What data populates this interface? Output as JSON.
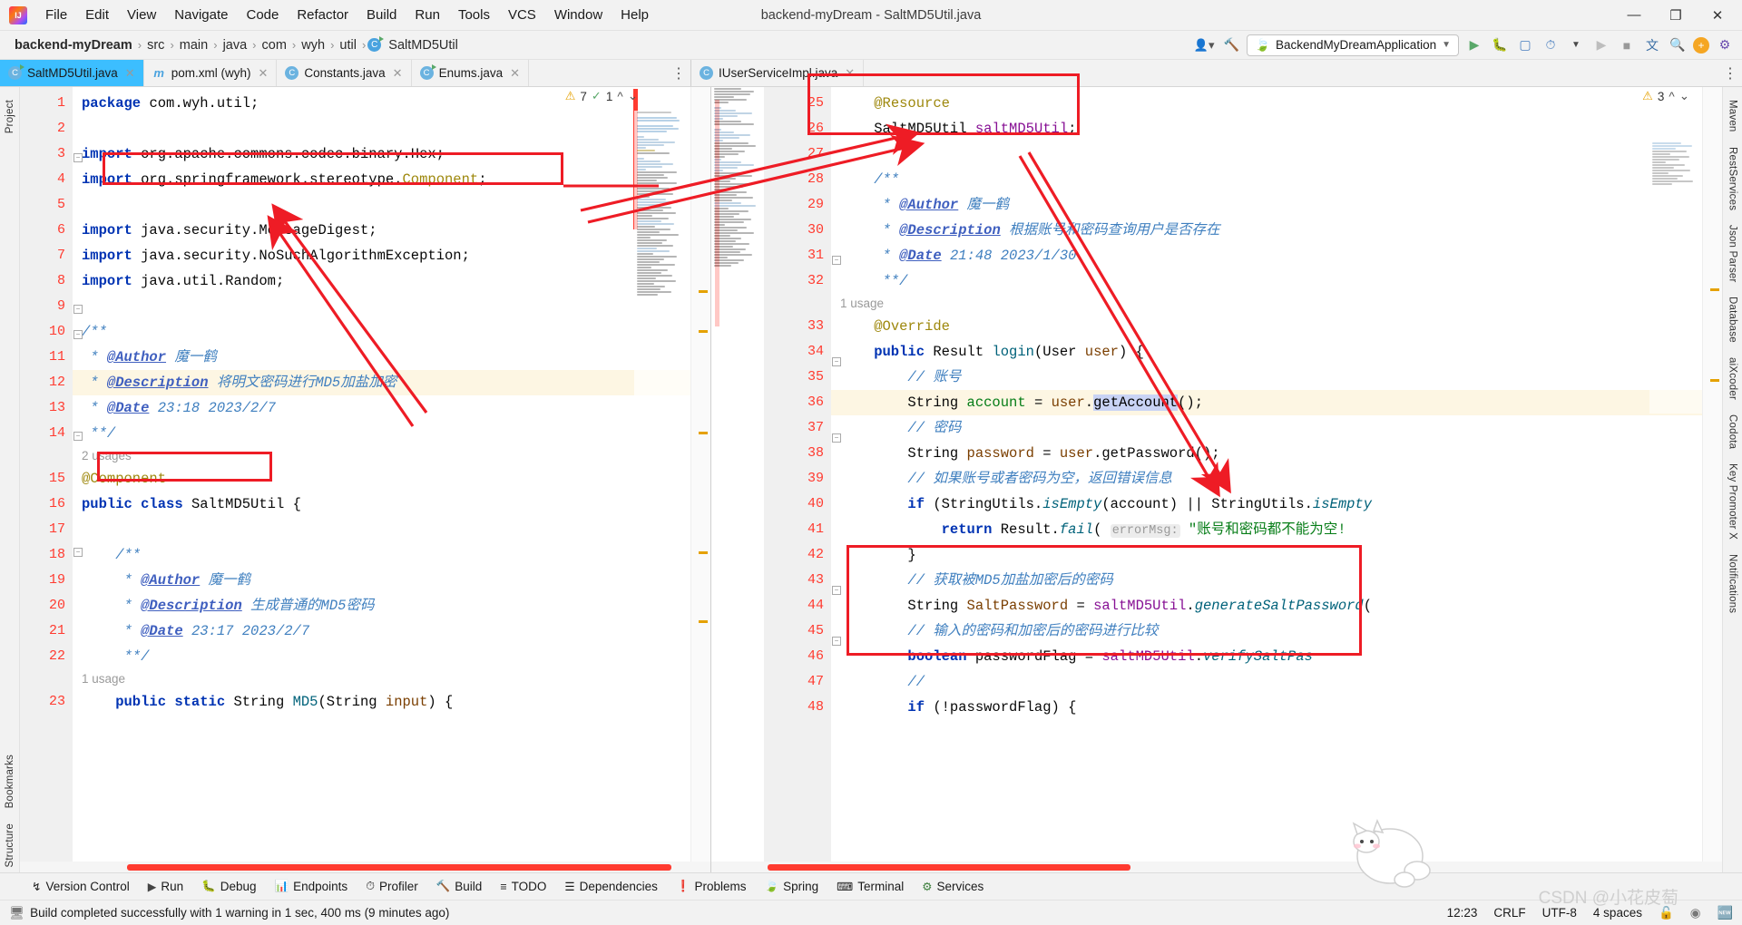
{
  "window": {
    "title": "backend-myDream - SaltMD5Util.java",
    "logo": "intellij-idea-logo",
    "controls": {
      "minimize": "—",
      "maximize": "❐",
      "close": "✕"
    }
  },
  "menubar": {
    "items": [
      "File",
      "Edit",
      "View",
      "Navigate",
      "Code",
      "Refactor",
      "Build",
      "Run",
      "Tools",
      "VCS",
      "Window",
      "Help"
    ]
  },
  "navbar": {
    "crumbs": [
      "backend-myDream",
      "src",
      "main",
      "java",
      "com",
      "wyh",
      "util",
      "SaltMD5Util"
    ],
    "separator": "›",
    "run_config": "BackendMyDreamApplication",
    "right_icons": [
      "account-icon",
      "hammer-icon",
      "run-icon",
      "debug-icon",
      "run-coverage-icon",
      "profile-icon",
      "stop-icon",
      "translate-icon",
      "search-icon",
      "updates-icon",
      "settings-icon"
    ]
  },
  "tabs_left": [
    {
      "label": "SaltMD5Util.java",
      "icon": "java-class-icon",
      "active": true
    },
    {
      "label": "pom.xml (wyh)",
      "icon": "maven-icon",
      "active": false
    },
    {
      "label": "Constants.java",
      "icon": "java-class-icon",
      "active": false
    },
    {
      "label": "Enums.java",
      "icon": "java-class-icon",
      "active": false
    }
  ],
  "tabs_right": [
    {
      "label": "IUserServiceImpl.java",
      "icon": "java-class-icon",
      "active": true
    }
  ],
  "left_rail": {
    "top": "Project",
    "bottom": [
      "Bookmarks",
      "Structure"
    ]
  },
  "right_rail": {
    "items": [
      "Maven",
      "RestServices",
      "Json Parser",
      "Database",
      "aiXcoder",
      "Codota",
      "Key Promoter X",
      "Notifications"
    ]
  },
  "inspections": {
    "left": {
      "warnings": "7",
      "checks": "1"
    },
    "right": {
      "warnings": "3"
    }
  },
  "editor_left": {
    "file": "SaltMD5Util.java",
    "first_line": 1,
    "lines": [
      {
        "n": 1,
        "text": "package com.wyh.util;"
      },
      {
        "n": 2,
        "text": ""
      },
      {
        "n": 3,
        "text": "import org.apache.commons.codec.binary.Hex;"
      },
      {
        "n": 4,
        "text": "import org.springframework.stereotype.Component;"
      },
      {
        "n": 5,
        "text": ""
      },
      {
        "n": 6,
        "text": "import java.security.MessageDigest;"
      },
      {
        "n": 7,
        "text": "import java.security.NoSuchAlgorithmException;"
      },
      {
        "n": 8,
        "text": "import java.util.Random;"
      },
      {
        "n": 9,
        "text": ""
      },
      {
        "n": 10,
        "text": "/**"
      },
      {
        "n": 11,
        "text": " * @Author 魏一鹤"
      },
      {
        "n": 12,
        "text": " * @Description 将明文密码进行MD5加盐加密"
      },
      {
        "n": 13,
        "text": " * @Date 23:18 2023/2/7"
      },
      {
        "n": 14,
        "text": " **/"
      },
      {
        "n": 15,
        "text": "@Component",
        "above": "2 usages"
      },
      {
        "n": 16,
        "text": "public class SaltMD5Util {"
      },
      {
        "n": 17,
        "text": ""
      },
      {
        "n": 18,
        "text": "    /**"
      },
      {
        "n": 19,
        "text": "     * @Author 魏一鹤"
      },
      {
        "n": 20,
        "text": "     * @Description 生成普通的MD5密码"
      },
      {
        "n": 21,
        "text": "     * @Date 23:17 2023/2/7"
      },
      {
        "n": 22,
        "text": "     **/"
      },
      {
        "n": 23,
        "text": "    public static String MD5(String input) {",
        "above": "1 usage"
      }
    ]
  },
  "editor_right": {
    "file": "IUserServiceImpl.java",
    "lines": [
      {
        "n": 25,
        "text": "    @Resource"
      },
      {
        "n": 26,
        "text": "    SaltMD5Util saltMD5Util;"
      },
      {
        "n": 27,
        "text": ""
      },
      {
        "n": 28,
        "text": "    /**"
      },
      {
        "n": 29,
        "text": "     * @Author 魏一鹤"
      },
      {
        "n": 30,
        "text": "     * @Description 根据账号和密码查询用户是否存在"
      },
      {
        "n": 31,
        "text": "     * @Date 21:48 2023/1/30"
      },
      {
        "n": 32,
        "text": "     **/"
      },
      {
        "n": 33,
        "text": "    @Override",
        "above": "1 usage"
      },
      {
        "n": 34,
        "text": "    public Result login(User user) {"
      },
      {
        "n": 35,
        "text": "        // 账号"
      },
      {
        "n": 36,
        "text": "        String account = user.getAccount();"
      },
      {
        "n": 37,
        "text": "        // 密码"
      },
      {
        "n": 38,
        "text": "        String password = user.getPassword();"
      },
      {
        "n": 39,
        "text": "        // 如果账号或者密码为空，返回错误信息"
      },
      {
        "n": 40,
        "text": "        if (StringUtils.isEmpty(account) || StringUtils.isEmpty"
      },
      {
        "n": 41,
        "text": "            return Result.fail( errorMsg: \"账号和密码都不能为空!"
      },
      {
        "n": 42,
        "text": "        }"
      },
      {
        "n": 43,
        "text": "        // 获取被MD5加盐加密后的密码"
      },
      {
        "n": 44,
        "text": "        String SaltPassword = saltMD5Util.generateSaltPassword("
      },
      {
        "n": 45,
        "text": "        // 输入的密码和加密后的密码进行比较"
      },
      {
        "n": 46,
        "text": "        boolean passwordFlag = saltMD5Util.verifySaltPas"
      },
      {
        "n": 47,
        "text": "        //"
      },
      {
        "n": 48,
        "text": "        if (!passwordFlag) {"
      }
    ]
  },
  "annotations": {
    "boxes": [
      "import-component-box",
      "component-annotation-box",
      "resource-field-box",
      "salt-md5-usage-box"
    ],
    "arrows": [
      "arrow-to-import",
      "arrow-to-resource",
      "arrow-to-salt-usage"
    ],
    "color": "#ee1c25"
  },
  "bottom_toolwindows": [
    {
      "label": "Version Control",
      "icon": "branch-icon"
    },
    {
      "label": "Run",
      "icon": "play-icon"
    },
    {
      "label": "Debug",
      "icon": "bug-icon"
    },
    {
      "label": "Endpoints",
      "icon": "endpoints-icon"
    },
    {
      "label": "Profiler",
      "icon": "profiler-icon"
    },
    {
      "label": "Build",
      "icon": "hammer-icon"
    },
    {
      "label": "TODO",
      "icon": "todo-icon"
    },
    {
      "label": "Dependencies",
      "icon": "dependencies-icon"
    },
    {
      "label": "Problems",
      "icon": "problems-icon"
    },
    {
      "label": "Spring",
      "icon": "spring-icon"
    },
    {
      "label": "Terminal",
      "icon": "terminal-icon"
    },
    {
      "label": "Services",
      "icon": "services-icon"
    }
  ],
  "statusbar": {
    "message": "Build completed successfully with 1 warning in 1 sec, 400 ms (9 minutes ago)",
    "message_icon": "build-status-icon",
    "position": "12:23",
    "line_separator": "CRLF",
    "encoding": "UTF-8",
    "indent": "4 spaces",
    "lock_icon": "unlocked-icon"
  },
  "watermark": "CSDN @小花皮萄"
}
